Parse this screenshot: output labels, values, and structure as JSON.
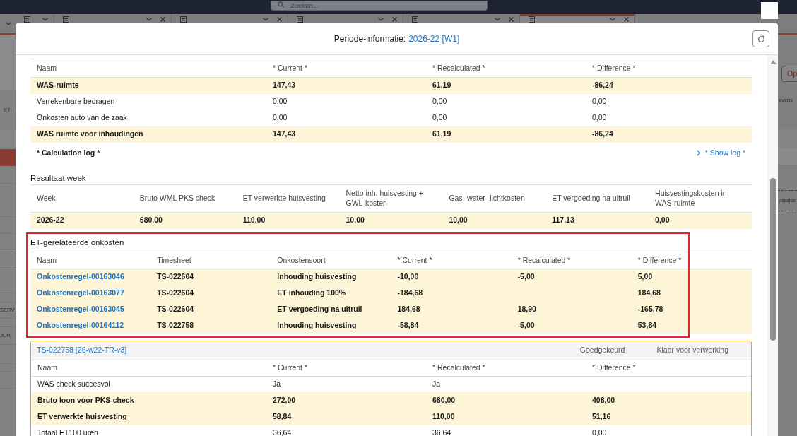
{
  "background": {
    "search": {
      "placeholder": "Zoeken..."
    },
    "tabs": [
      {
        "selected": false,
        "closable": false
      },
      {
        "selected": false,
        "closable": true
      },
      {
        "selected": false,
        "closable": true
      },
      {
        "selected": false,
        "closable": true
      },
      {
        "selected": false,
        "closable": true
      },
      {
        "selected": true,
        "closable": true
      }
    ],
    "left_texts": [
      {
        "kind": "link",
        "text": "ET-"
      },
      {
        "kind": "text",
        "text": "SERV"
      },
      {
        "kind": "text",
        "text": "JUR"
      }
    ],
    "right_button": {
      "label": "Op"
    },
    "right_texts": [
      "evens",
      "plaatse"
    ]
  },
  "modal": {
    "title": "Periode-informatie:",
    "period_link": "2026-22 [W1]",
    "was_table": {
      "columns": [
        "Naam",
        "* Current *",
        "* Recalculated *",
        "* Difference *"
      ],
      "rows": [
        {
          "name": "WAS-ruimte",
          "current": "147,43",
          "recalculated": "61,19",
          "difference": "-86,24",
          "emphasized": true
        },
        {
          "name": "Verrekenbare bedragen",
          "current": "0,00",
          "recalculated": "0,00",
          "difference": "0,00",
          "emphasized": false
        },
        {
          "name": "Onkosten auto van de zaak",
          "current": "0,00",
          "recalculated": "0,00",
          "difference": "0,00",
          "emphasized": false
        },
        {
          "name": "WAS ruimte voor inhoudingen",
          "current": "147,43",
          "recalculated": "61,19",
          "difference": "-86,24",
          "emphasized": true
        }
      ]
    },
    "calculation_log": {
      "label": "* Calculation log *",
      "link": "* Show log *"
    },
    "result_week": {
      "title": "Resultaat week",
      "columns": [
        "Week",
        "Bruto WML PKS check",
        "ET verwerkte huisvesting",
        "Netto inh. huisvesting + GWL-kosten",
        "Gas- water- lichtkosten",
        "ET vergoeding na uitruil",
        "Huisvestingskosten in WAS-ruimte"
      ],
      "rows": [
        {
          "cells": [
            "2026-22",
            "680,00",
            "110,00",
            "10,00",
            "10,00",
            "117,13",
            "0,00"
          ],
          "emphasized": true
        }
      ]
    },
    "expenses": {
      "title": "ET-gerelateerde onkosten",
      "highlighted": true,
      "columns": [
        "Naam",
        "Timesheet",
        "Onkostensoort",
        "* Current *",
        "* Recalculated *",
        "* Difference *"
      ],
      "rows": [
        {
          "name": "Onkostenregel-00163046",
          "timesheet": "TS-022604",
          "expense_type": "Inhouding huisvesting",
          "current": "-10,00",
          "recalculated": "-5,00",
          "difference": "5,00",
          "emphasized": true
        },
        {
          "name": "Onkostenregel-00163077",
          "timesheet": "TS-022604",
          "expense_type": "ET inhouding 100%",
          "current": "-184,68",
          "difference": "184,68",
          "emphasized": true
        },
        {
          "name": "Onkostenregel-00163045",
          "timesheet": "TS-022604",
          "expense_type": "ET vergoeding na uitruil",
          "current": "184,68",
          "recalculated": "18,90",
          "difference": "-165,78",
          "emphasized": true
        },
        {
          "name": "Onkostenregel-00164112",
          "timesheet": "TS-022758",
          "expense_type": "Inhouding huisvesting",
          "current": "-58,84",
          "recalculated": "-5,00",
          "difference": "53,84",
          "emphasized": true
        }
      ]
    },
    "timesheet_card": {
      "title": "TS-022758 [26-w22-TR-v3]",
      "status": "Goedgekeurd",
      "processing": "Klaar voor verwerking",
      "columns": [
        "Naam",
        "* Current *",
        "* Recalculated *",
        "* Difference *"
      ],
      "rows": [
        {
          "name": "WAS check succesvol",
          "current": "Ja",
          "recalculated": "Ja",
          "emphasized": false
        },
        {
          "name": "Bruto loon voor PKS-check",
          "current": "272,00",
          "recalculated": "680,00",
          "difference": "408,00",
          "emphasized": true
        },
        {
          "name": "ET verwerkte huisvesting",
          "current": "58,84",
          "recalculated": "110,00",
          "difference": "51,16",
          "emphasized": true
        },
        {
          "name": "Totaal ET100 uren",
          "current": "36,64",
          "recalculated": "36,64",
          "difference": "0,00",
          "emphasized": false
        }
      ]
    }
  }
}
